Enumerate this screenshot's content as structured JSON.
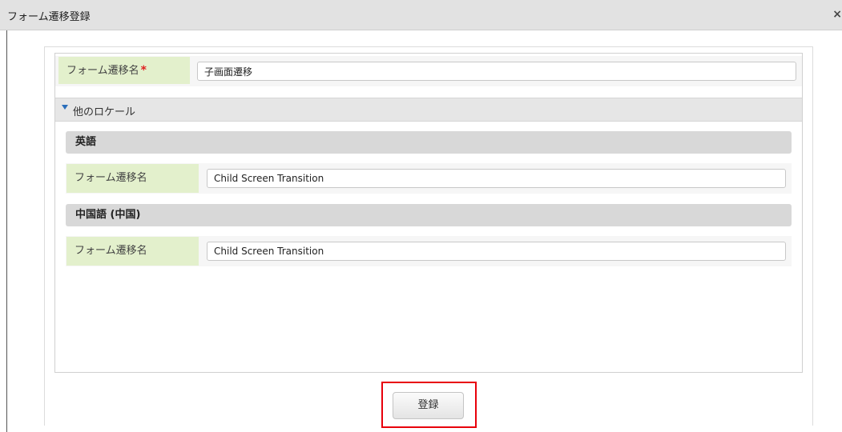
{
  "dialog": {
    "title": "フォーム遷移登録",
    "close_symbol": "×"
  },
  "main_field": {
    "label": "フォーム遷移名",
    "required_mark": "*",
    "value": "子画面遷移"
  },
  "other_locales": {
    "header": "他のロケール",
    "expanded": true,
    "sections": [
      {
        "title": "英語",
        "field_label": "フォーム遷移名",
        "value": "Child Screen Transition"
      },
      {
        "title": "中国語 (中国)",
        "field_label": "フォーム遷移名",
        "value": "Child Screen Transition"
      }
    ]
  },
  "footer": {
    "register_label": "登録"
  },
  "colors": {
    "title_bar": "#e2e2e2",
    "label_background": "#e3f0cc",
    "required": "#e02020",
    "highlight_frame": "#e8000b",
    "caret": "#2a6ebb"
  },
  "icons": {
    "close": "close-icon",
    "expand": "caret-down-icon"
  }
}
